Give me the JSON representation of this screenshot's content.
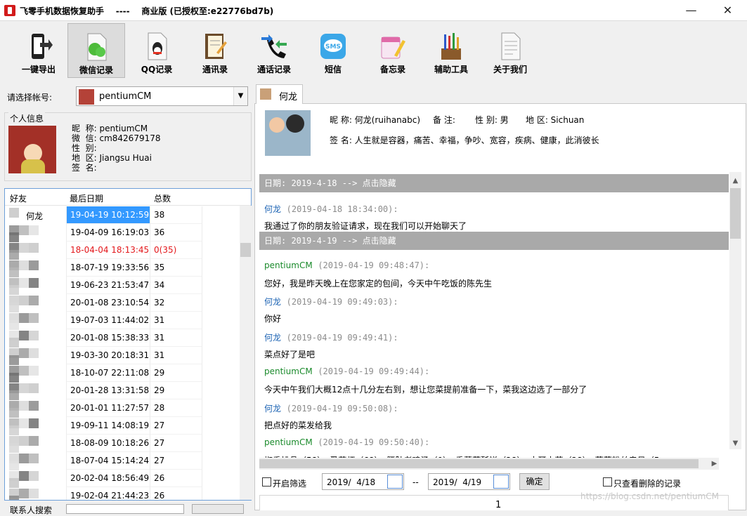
{
  "window": {
    "title": "飞零手机数据恢复助手    ----    商业版 (已授权至:e22776bd7b)",
    "minimize": "—",
    "close": "✕"
  },
  "toolbar": [
    {
      "label": "一键导出",
      "icon": "phone-export-icon"
    },
    {
      "label": "微信记录",
      "icon": "wechat-icon",
      "active": true
    },
    {
      "label": "QQ记录",
      "icon": "qq-icon"
    },
    {
      "label": "通讯录",
      "icon": "contacts-icon"
    },
    {
      "label": "通话记录",
      "icon": "phone-call-icon"
    },
    {
      "label": "短信",
      "icon": "sms-icon"
    },
    {
      "label": "备忘录",
      "icon": "memo-icon"
    },
    {
      "label": "辅助工具",
      "icon": "tools-icon"
    },
    {
      "label": "关于我们",
      "icon": "about-icon"
    }
  ],
  "account": {
    "label": "请选择帐号:",
    "selected": "pentiumCM"
  },
  "personal": {
    "legend": "个人信息",
    "rows": [
      "昵  称: pentiumCM",
      "微  信: cm842679178",
      "性  别:",
      "地  区: Jiangsu Huai",
      "签  名:"
    ]
  },
  "friends": {
    "headers": [
      "好友",
      "最后日期",
      "总数"
    ],
    "rows": [
      {
        "name": "何龙",
        "date": "19-04-19 10:12:59",
        "count": "38",
        "selected": true
      },
      {
        "name": "",
        "date": "19-04-09 16:19:03",
        "count": "36"
      },
      {
        "name": "",
        "date": "18-04-04 18:13:45",
        "count": "0(35)",
        "deleted": true
      },
      {
        "name": "",
        "date": "18-07-19 19:33:56",
        "count": "35"
      },
      {
        "name": "",
        "date": "19-06-23 21:53:47",
        "count": "34"
      },
      {
        "name": "",
        "date": "20-01-08 23:10:54",
        "count": "32"
      },
      {
        "name": "",
        "date": "19-07-03 11:44:02",
        "count": "31"
      },
      {
        "name": "",
        "date": "20-01-08 15:38:33",
        "count": "31"
      },
      {
        "name": "",
        "date": "19-03-30 20:18:31",
        "count": "31"
      },
      {
        "name": "",
        "date": "18-10-07 22:11:08",
        "count": "29"
      },
      {
        "name": "",
        "date": "20-01-28 13:31:58",
        "count": "29"
      },
      {
        "name": "",
        "date": "20-01-01 11:27:57",
        "count": "28"
      },
      {
        "name": "",
        "date": "19-09-11 14:08:19",
        "count": "27"
      },
      {
        "name": "",
        "date": "18-08-09 10:18:26",
        "count": "27"
      },
      {
        "name": "",
        "date": "18-07-04 15:14:24",
        "count": "27"
      },
      {
        "name": "",
        "date": "20-02-04 18:56:49",
        "count": "26"
      },
      {
        "name": "",
        "date": "19-02-04 21:44:23",
        "count": "26"
      }
    ]
  },
  "search": {
    "label": "联系人搜索"
  },
  "chat_tab": {
    "label": "何龙"
  },
  "profile": {
    "nickname": "昵 称: 何龙(ruihanabc)",
    "note": "备 注:",
    "gender": "性 别: 男",
    "region": "地 区: Sichuan",
    "signature": "签 名: 人生就是容器，痛苦、幸福，争吵、宽容，疾病、健康，此消彼长"
  },
  "chat": [
    {
      "type": "date",
      "text": "日期: 2019-4-18  --> 点击隐藏"
    },
    {
      "type": "msg",
      "who": "friend",
      "name": "何龙",
      "time": "(2019-04-18 18:34:00):",
      "text": "我通过了你的朋友验证请求，现在我们可以开始聊天了"
    },
    {
      "type": "date",
      "text": "日期: 2019-4-19  --> 点击隐藏"
    },
    {
      "type": "msg",
      "who": "self",
      "name": "pentiumCM",
      "time": "(2019-04-19 09:48:47):",
      "text": "您好，我是昨天晚上在您家定的包间，今天中午吃饭的陈先生"
    },
    {
      "type": "msg",
      "who": "friend",
      "name": "何龙",
      "time": "(2019-04-19 09:49:03):",
      "text": "你好"
    },
    {
      "type": "msg",
      "who": "friend",
      "name": "何龙",
      "time": "(2019-04-19 09:49:41):",
      "text": "菜点好了是吧"
    },
    {
      "type": "msg",
      "who": "self",
      "name": "pentiumCM",
      "time": "(2019-04-19 09:49:44):",
      "text": "今天中午我们大概12点十几分左右到，想让您菜提前准备一下，菜我这边选了一部分了"
    },
    {
      "type": "msg",
      "who": "friend",
      "name": "何龙",
      "time": "(2019-04-19 09:50:08):",
      "text": "把点好的菜发给我"
    },
    {
      "type": "msg",
      "who": "self",
      "name": "pentiumCM",
      "time": "(2019-04-19 09:50:40):",
      "text": "椒香排骨（58）、蚤菜虾（68）、腰肚老鸡汤（0）、香葱荷酥饼（28）、木耳山药（28）、菇菇粉丝扇贝（5"
    }
  ],
  "filter": {
    "enable_label": "开启筛选",
    "date_from": "2019/  4/18",
    "separator": "--",
    "date_to": "2019/  4/19",
    "ok": "确定",
    "deleted_only": "只查看删除的记录"
  },
  "pager": {
    "page": "1"
  },
  "watermark": "https://blog.csdn.net/pentiumCM",
  "colors": {
    "selection": "#3399ff",
    "deleted": "#e3171b",
    "friend_name": "#1e64b4",
    "self_name": "#1a8a2b",
    "date_band": "#a9a9a9"
  }
}
